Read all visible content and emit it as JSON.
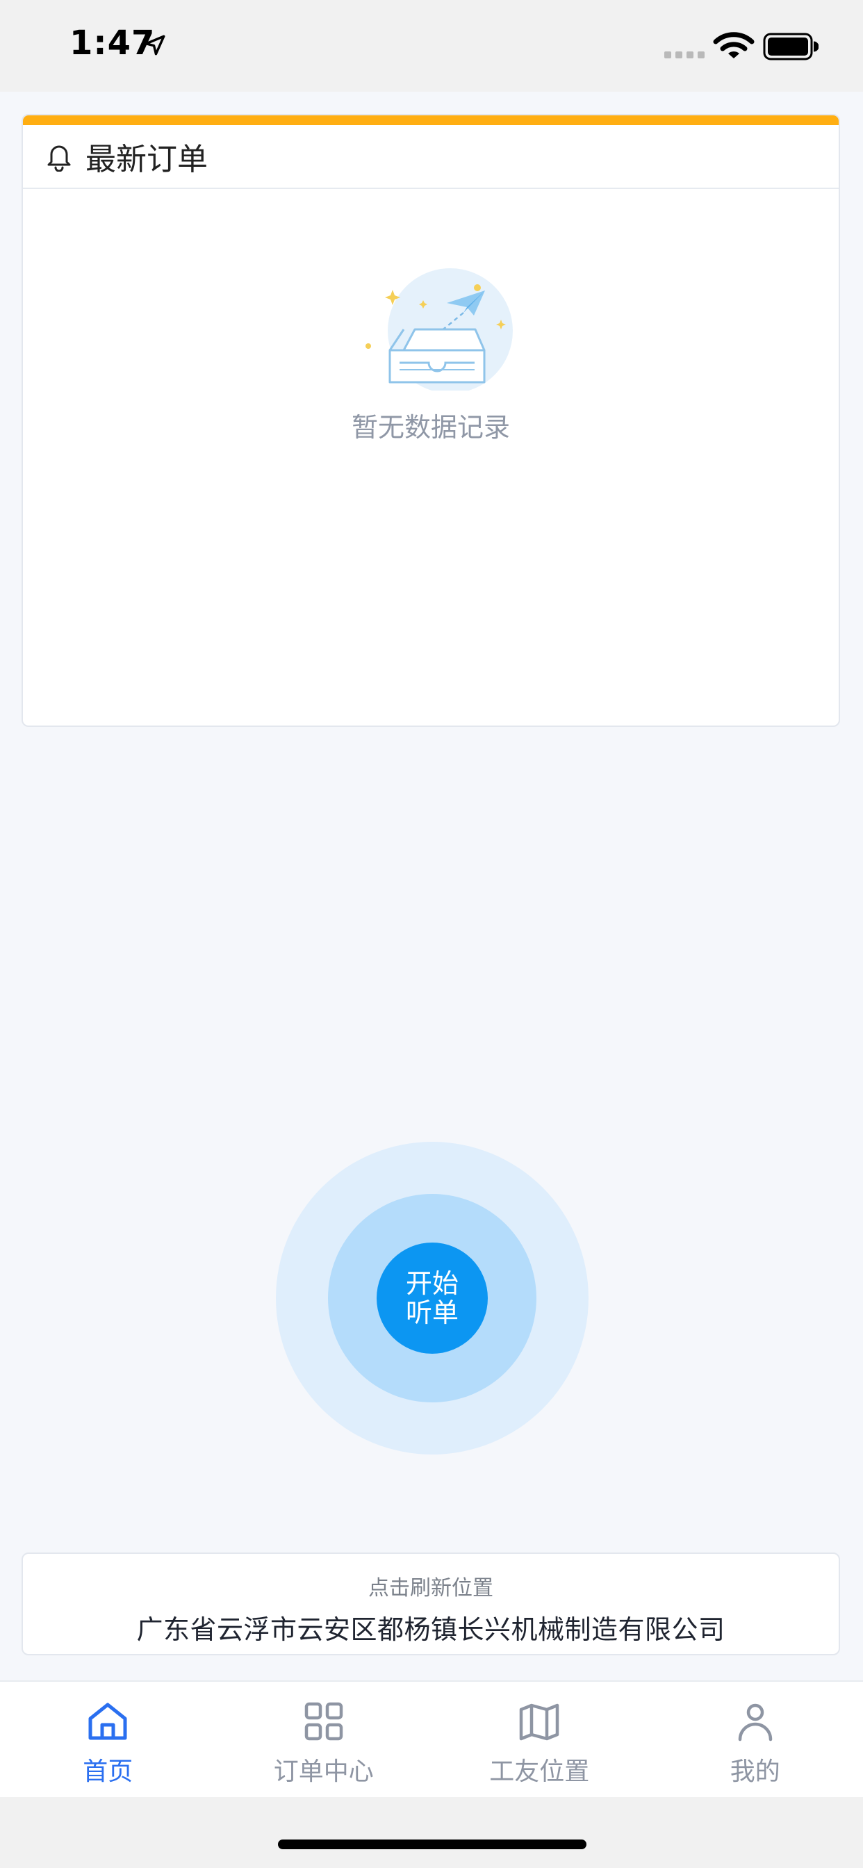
{
  "status_bar": {
    "time": "1:47",
    "icons": [
      "location-arrow-icon",
      "signal-dots-icon",
      "wifi-icon",
      "battery-icon"
    ]
  },
  "orders": {
    "title": "最新订单",
    "empty_text": "暂无数据记录",
    "accent_color": "#ffae12"
  },
  "listen_button": {
    "line1": "开始",
    "line2": "听单",
    "color": "#0c96f2"
  },
  "location": {
    "hint": "点击刷新位置",
    "address": "广东省云浮市云安区都杨镇长兴机械制造有限公司"
  },
  "tabs": [
    {
      "label": "首页",
      "icon": "home-icon",
      "active": true
    },
    {
      "label": "订单中心",
      "icon": "grid-icon",
      "active": false
    },
    {
      "label": "工友位置",
      "icon": "map-icon",
      "active": false
    },
    {
      "label": "我的",
      "icon": "user-icon",
      "active": false
    }
  ],
  "colors": {
    "active_tab": "#2a6ff0",
    "inactive_tab": "#8e95a3"
  }
}
